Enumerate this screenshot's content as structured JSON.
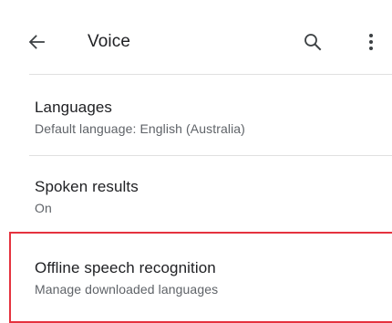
{
  "appbar": {
    "title": "Voice",
    "back_icon": "arrow-back-icon",
    "search_icon": "search-icon",
    "more_icon": "more-vert-icon"
  },
  "settings": {
    "items": [
      {
        "title": "Languages",
        "subtitle": "Default language: English (Australia)"
      },
      {
        "title": "Spoken results",
        "subtitle": "On"
      },
      {
        "title": "Offline speech recognition",
        "subtitle": "Manage downloaded languages"
      }
    ]
  },
  "colors": {
    "highlight": "#e5323e",
    "text_primary": "#202124",
    "text_secondary": "#5f6368",
    "divider": "#e0e0e0"
  }
}
